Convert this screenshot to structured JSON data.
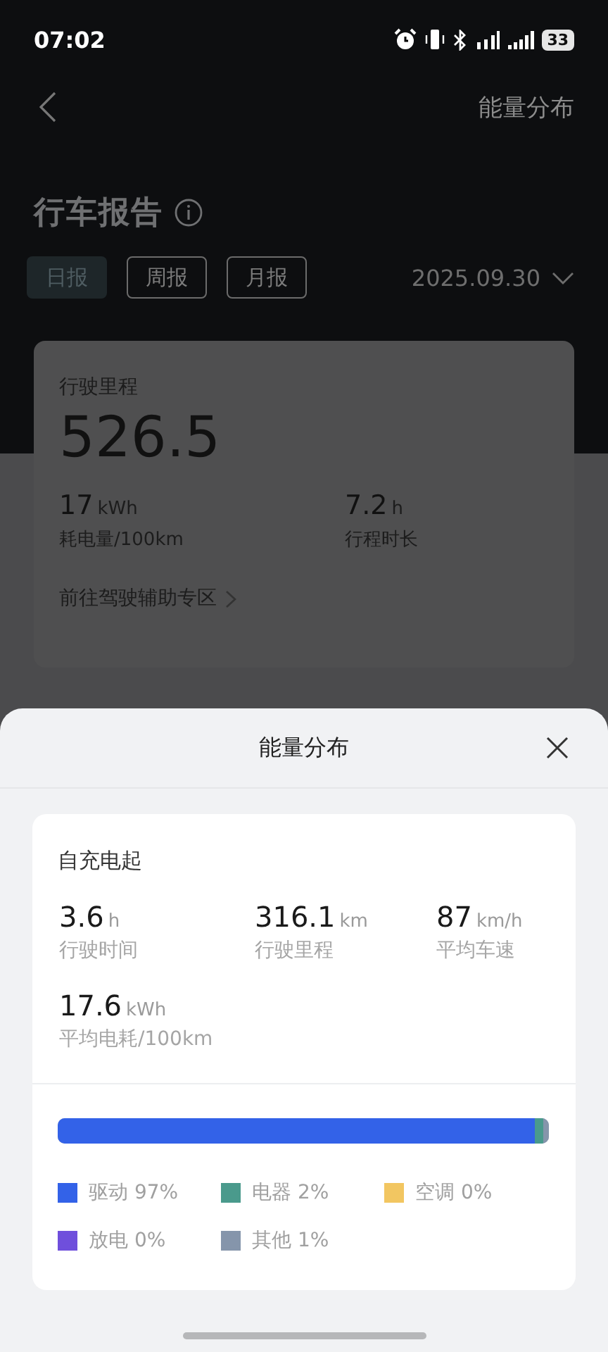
{
  "status_bar": {
    "time": "07:02",
    "battery": "33"
  },
  "header": {
    "action": "能量分布"
  },
  "report": {
    "title": "行车报告",
    "date": "2025.09.30",
    "tabs": [
      {
        "label": "日报",
        "selected": true
      },
      {
        "label": "周报",
        "selected": false
      },
      {
        "label": "月报",
        "selected": false
      }
    ]
  },
  "summary": {
    "label": "行驶里程",
    "value": "526.5",
    "link": "前往驾驶辅助专区",
    "stats": [
      {
        "value": "17",
        "unit": "kWh",
        "label": "耗电量/100km"
      },
      {
        "value": "7.2",
        "unit": "h",
        "label": "行程时长"
      }
    ]
  },
  "sheet": {
    "title": "能量分布",
    "section": "自充电起",
    "stats": [
      {
        "value": "3.6",
        "unit": "h",
        "label": "行驶时间"
      },
      {
        "value": "316.1",
        "unit": "km",
        "label": "行驶里程"
      },
      {
        "value": "87",
        "unit": "km/h",
        "label": "平均车速"
      },
      {
        "value": "17.6",
        "unit": "kWh",
        "label": "平均电耗/100km"
      }
    ],
    "energy": [
      {
        "label": "驱动 97%",
        "color": "#3362e8",
        "level": 0.97
      },
      {
        "label": "电器 2%",
        "color": "#4a9a8c",
        "level": 0.02
      },
      {
        "label": "空调 0%",
        "color": "#f2c661",
        "level": 0
      },
      {
        "label": "放电 0%",
        "color": "#6f4fdc",
        "level": 0
      },
      {
        "label": "其他 1%",
        "color": "#8595ab",
        "level": 0.01
      }
    ]
  }
}
